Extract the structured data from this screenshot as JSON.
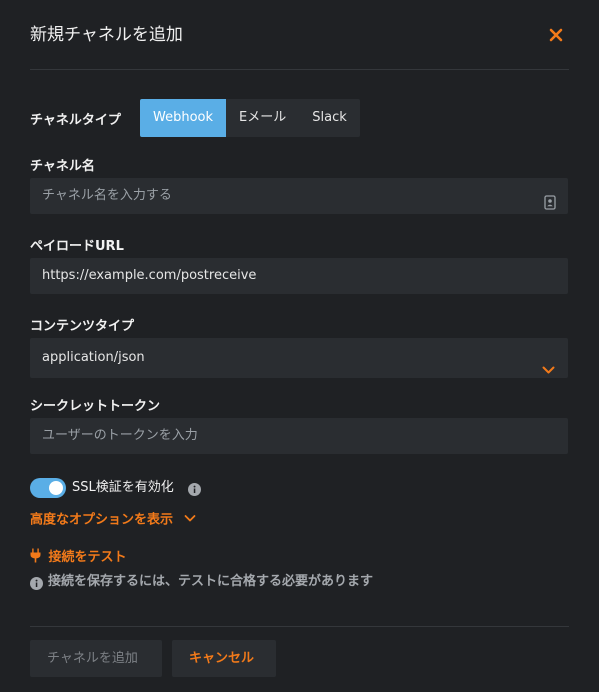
{
  "dialog": {
    "title": "新規チャネルを追加"
  },
  "channel_type": {
    "label": "チャネルタイプ",
    "options": [
      "Webhook",
      "Eメール",
      "Slack"
    ],
    "selected": "Webhook"
  },
  "channel_name": {
    "label": "チャネル名",
    "placeholder": "チャネル名を入力する"
  },
  "payload_url": {
    "label": "ペイロードURL",
    "value": "https://example.com/postreceive"
  },
  "content_type": {
    "label": "コンテンツタイプ",
    "value": "application/json"
  },
  "secret_token": {
    "label": "シークレットトークン",
    "placeholder": "ユーザーのトークンを入力"
  },
  "ssl": {
    "label": "SSL検証を有効化",
    "enabled": true
  },
  "advanced": {
    "label": "高度なオプションを表示"
  },
  "test": {
    "label": "接続をテスト",
    "note": "接続を保存するには、テストに合格する必要があります"
  },
  "footer": {
    "add_label": "チャネルを追加",
    "cancel_label": "キャンセル"
  },
  "colors": {
    "accent": "#5aaee6",
    "orange": "#f27a1a",
    "background": "#1f2124",
    "input_bg": "#2a2d31"
  }
}
